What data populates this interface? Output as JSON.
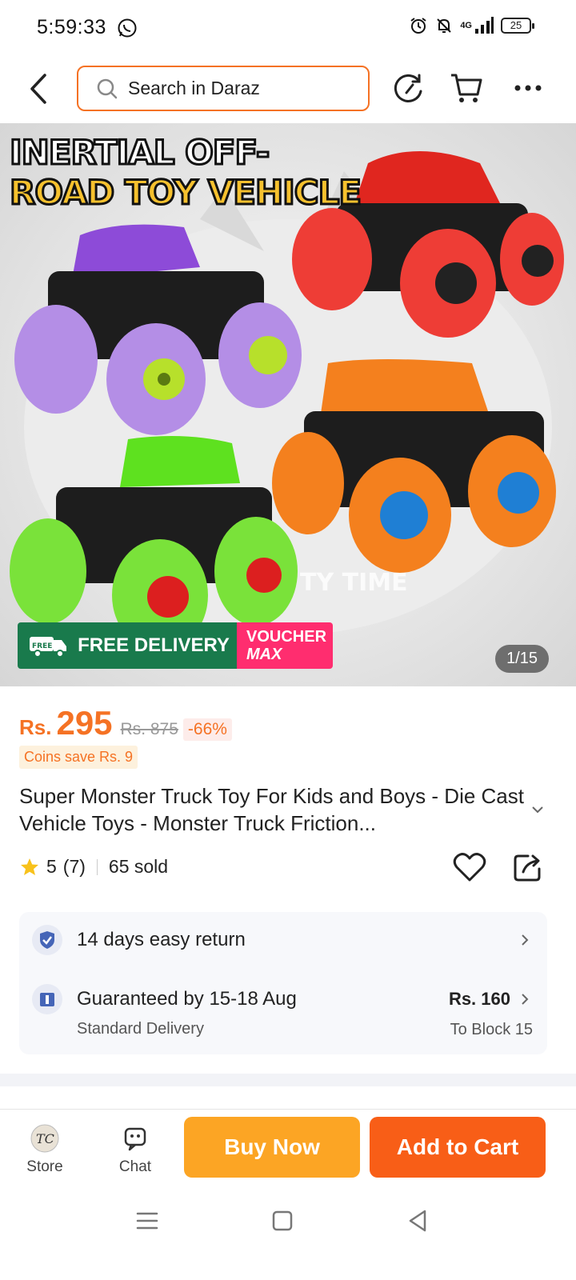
{
  "status_bar": {
    "time": "5:59:33",
    "network": "4G",
    "battery": "25"
  },
  "header": {
    "search_placeholder": "Search in Daraz"
  },
  "hero": {
    "title_line1": "INERTIAL OFF-",
    "title_line2": "ROAD TOY VEHICLE",
    "free_delivery": "FREE DELIVERY",
    "free_tag": "FREE",
    "voucher_line1": "VOUCHER",
    "voucher_line2": "MAX",
    "counter": "1/15",
    "background_text": "TY TIME"
  },
  "product": {
    "currency": "Rs.",
    "price": "295",
    "old_price": "Rs. 875",
    "discount": "-66%",
    "coins": "Coins save Rs. 9",
    "title": "Super Monster Truck Toy For Kids and Boys - Die Cast Vehicle Toys - Monster Truck Friction...",
    "rating": "5",
    "reviews": "(7)",
    "sold": "65 sold"
  },
  "info": {
    "return": "14 days easy return",
    "guarantee": "Guaranteed by 15-18 Aug",
    "delivery_type": "Standard Delivery",
    "fee": "Rs. 160",
    "destination": "To Block 15"
  },
  "actions": {
    "store": "Store",
    "chat": "Chat",
    "buy_now": "Buy Now",
    "add_to_cart": "Add to Cart"
  },
  "colors": {
    "accent": "#f57224",
    "buy": "#fca524",
    "add": "#f85e17",
    "delivery_green": "#197a4c",
    "voucher_pink": "#ff2d6f"
  }
}
